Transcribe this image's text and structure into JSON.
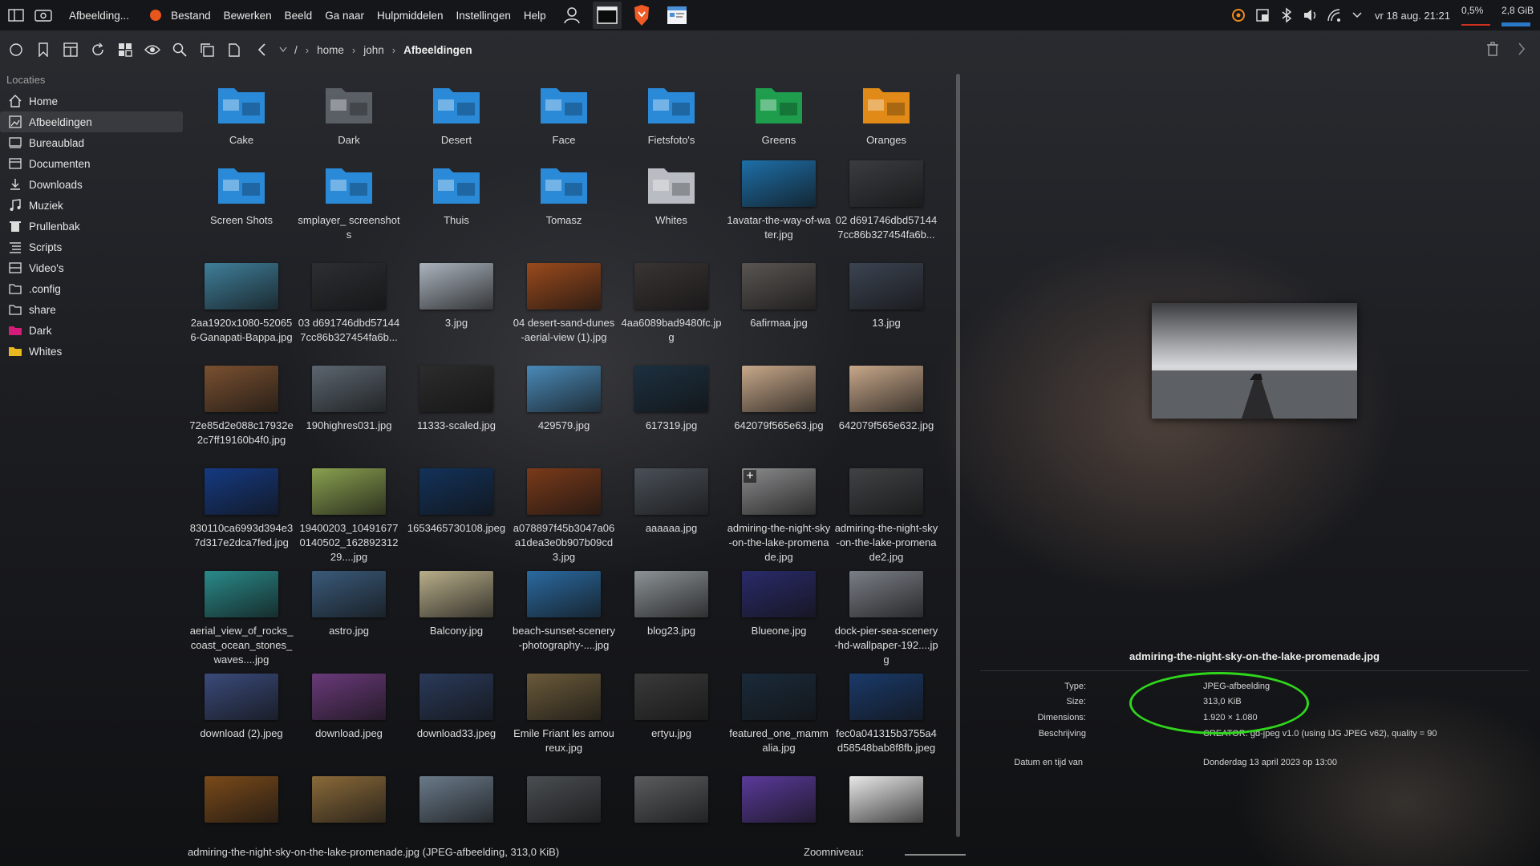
{
  "topbar": {
    "app_title": "Afbeelding...",
    "menu": [
      "Bestand",
      "Bewerken",
      "Beeld",
      "Ga naar",
      "Hulpmiddelen",
      "Instellingen",
      "Help"
    ],
    "clock": "vr 18 aug. 21:21",
    "cpu": "0,5%",
    "memory": "2,8 GiB"
  },
  "breadcrumb": {
    "root": "/",
    "parts": [
      "home",
      "john"
    ],
    "current": "Afbeeldingen"
  },
  "sidebar": {
    "heading": "Locaties",
    "items": [
      {
        "label": "Home",
        "icon": "home-icon"
      },
      {
        "label": "Afbeeldingen",
        "icon": "pictures-icon",
        "active": true
      },
      {
        "label": "Bureaublad",
        "icon": "desktop-icon"
      },
      {
        "label": "Documenten",
        "icon": "documents-icon"
      },
      {
        "label": "Downloads",
        "icon": "download-icon"
      },
      {
        "label": "Muziek",
        "icon": "music-icon"
      },
      {
        "label": "Prullenbak",
        "icon": "trash-icon"
      },
      {
        "label": "Scripts",
        "icon": "scripts-icon"
      },
      {
        "label": "Video's",
        "icon": "video-icon"
      },
      {
        "label": ".config",
        "icon": "folder-outline-icon"
      },
      {
        "label": "share",
        "icon": "folder-outline-icon"
      },
      {
        "label": "Dark",
        "icon": "folder-magenta-icon"
      },
      {
        "label": "Whites",
        "icon": "folder-yellow-icon"
      }
    ]
  },
  "files": [
    {
      "label": "Cake",
      "kind": "folder",
      "color": "#2a8ad8"
    },
    {
      "label": "Dark",
      "kind": "folder",
      "color": "#5b5f66"
    },
    {
      "label": "Desert",
      "kind": "folder",
      "color": "#2a8ad8"
    },
    {
      "label": "Face",
      "kind": "folder",
      "color": "#2a8ad8"
    },
    {
      "label": "Fietsfoto's",
      "kind": "folder",
      "color": "#2a8ad8"
    },
    {
      "label": "Greens",
      "kind": "folder",
      "color": "#1e9e4e"
    },
    {
      "label": "Oranges",
      "kind": "folder",
      "color": "#e08a18"
    },
    {
      "label": "Screen Shots",
      "kind": "folder",
      "color": "#2a8ad8"
    },
    {
      "label": "smplayer_ screenshots",
      "kind": "folder",
      "color": "#2a8ad8"
    },
    {
      "label": "Thuis",
      "kind": "folder",
      "color": "#2a8ad8"
    },
    {
      "label": "Tomasz",
      "kind": "folder",
      "color": "#2a8ad8"
    },
    {
      "label": "Whites",
      "kind": "folder",
      "color": "#b9bcc2"
    },
    {
      "label": "1avatar-the-way-of-water.jpg",
      "kind": "image",
      "color": "#1d6fa8"
    },
    {
      "label": "02 d691746dbd571447cc86b327454fa6b...",
      "kind": "image",
      "color": "#3a3c40"
    },
    {
      "label": "2aa1920x1080-520656-Ganapati-Bappa.jpg",
      "kind": "image",
      "color": "#3f7f9a"
    },
    {
      "label": "03 d691746dbd571447cc86b327454fa6b...",
      "kind": "image",
      "color": "#2c2e32"
    },
    {
      "label": "3.jpg",
      "kind": "image",
      "color": "#aab3bd"
    },
    {
      "label": "04 desert-sand-dunes-aerial-view (1).jpg",
      "kind": "image",
      "color": "#9a4a1c"
    },
    {
      "label": "4aa6089bad9480fc.jpg",
      "kind": "image",
      "color": "#3a3434"
    },
    {
      "label": "6afirmaa.jpg",
      "kind": "image",
      "color": "#5a5552"
    },
    {
      "label": "13.jpg",
      "kind": "image",
      "color": "#3c4452"
    },
    {
      "label": "72e85d2e088c17932e2c7ff19160b4f0.jpg",
      "kind": "image",
      "color": "#7a5030"
    },
    {
      "label": "190highres031.jpg",
      "kind": "image",
      "color": "#5c6670"
    },
    {
      "label": "11333-scaled.jpg",
      "kind": "image",
      "color": "#2c2c2c"
    },
    {
      "label": "429579.jpg",
      "kind": "image",
      "color": "#4a8ab8"
    },
    {
      "label": "617319.jpg",
      "kind": "image",
      "color": "#1c3040"
    },
    {
      "label": "642079f565e63.jpg",
      "kind": "image",
      "color": "#c8a88a"
    },
    {
      "label": "642079f565e632.jpg",
      "kind": "image",
      "color": "#c8a88a"
    },
    {
      "label": "830110ca6993d394e37d317e2dca7fed.jpg",
      "kind": "image",
      "color": "#153a82"
    },
    {
      "label": "19400203_104916770140502_16289231229....jpg",
      "kind": "image",
      "color": "#8aa050"
    },
    {
      "label": "1653465730108.jpeg",
      "kind": "image",
      "color": "#12325a"
    },
    {
      "label": "a078897f45b3047a06a1dea3e0b907b09cd3.jpg",
      "kind": "image",
      "color": "#7a3a1a"
    },
    {
      "label": "aaaaaa.jpg",
      "kind": "image",
      "color": "#4a5058"
    },
    {
      "label": "admiring-the-night-sky-on-the-lake-promenade.jpg",
      "kind": "image",
      "color": "#8a8a8c",
      "hovered": true
    },
    {
      "label": "admiring-the-night-sky-on-the-lake-promenade2.jpg",
      "kind": "image",
      "color": "#404244"
    },
    {
      "label": "aerial_view_of_rocks_coast_ocean_stones_waves....jpg",
      "kind": "image",
      "color": "#2a8a8a"
    },
    {
      "label": "astro.jpg",
      "kind": "image",
      "color": "#3a5a7a"
    },
    {
      "label": "Balcony.jpg",
      "kind": "image",
      "color": "#b8ae8a"
    },
    {
      "label": "beach-sunset-scenery-photography-....jpg",
      "kind": "image",
      "color": "#2a6aa0"
    },
    {
      "label": "blog23.jpg",
      "kind": "image",
      "color": "#8c9296"
    },
    {
      "label": "Blueone.jpg",
      "kind": "image",
      "color": "#2a2a6a"
    },
    {
      "label": "dock-pier-sea-scenery-hd-wallpaper-192....jpg",
      "kind": "image",
      "color": "#7a7e86"
    },
    {
      "label": "download (2).jpeg",
      "kind": "image",
      "color": "#3a4a7a"
    },
    {
      "label": "download.jpeg",
      "kind": "image",
      "color": "#6a3a7a"
    },
    {
      "label": "download33.jpeg",
      "kind": "image",
      "color": "#2a3a5a"
    },
    {
      "label": "Emile Friant les amoureux.jpg",
      "kind": "image",
      "color": "#6a5a3a"
    },
    {
      "label": "ertyu.jpg",
      "kind": "image",
      "color": "#3a3a3a"
    },
    {
      "label": "featured_one_mammalia.jpg",
      "kind": "image",
      "color": "#1a2a3a"
    },
    {
      "label": "fec0a041315b3755a4d58548bab8f8fb.jpeg",
      "kind": "image",
      "color": "#1a3a6a"
    },
    {
      "label": "",
      "kind": "image",
      "color": "#7a4a1a"
    },
    {
      "label": "",
      "kind": "image",
      "color": "#8a6a3a"
    },
    {
      "label": "",
      "kind": "image",
      "color": "#6a7a8a"
    },
    {
      "label": "",
      "kind": "image",
      "color": "#4a4e52"
    },
    {
      "label": "",
      "kind": "image",
      "color": "#5a5c5e"
    },
    {
      "label": "",
      "kind": "image",
      "color": "#5a3a9a"
    },
    {
      "label": "",
      "kind": "image",
      "color": "#e8e8e8"
    }
  ],
  "status": {
    "text": "admiring-the-night-sky-on-the-lake-promenade.jpg (JPEG-afbeelding, 313,0 KiB)",
    "zoom_label": "Zoomniveau:"
  },
  "info": {
    "filename": "admiring-the-night-sky-on-the-lake-promenade.jpg",
    "rows": [
      {
        "key": "Type:",
        "value": "JPEG-afbeelding"
      },
      {
        "key": "Size:",
        "value": "313,0 KiB"
      },
      {
        "key": "Dimensions:",
        "value": "1.920 × 1.080"
      },
      {
        "key": "Beschrijving",
        "value": "CREATOR: gd-jpeg v1.0 (using IJG JPEG v62), quality = 90"
      },
      {
        "key": "Datum en tijd van",
        "value": "Donderdag 13 april 2023 op 13:00"
      }
    ]
  },
  "colors": {
    "accent": "#2a8ad8",
    "highlight_ellipse": "#2fd61c",
    "panel_bg": "#14161a"
  }
}
